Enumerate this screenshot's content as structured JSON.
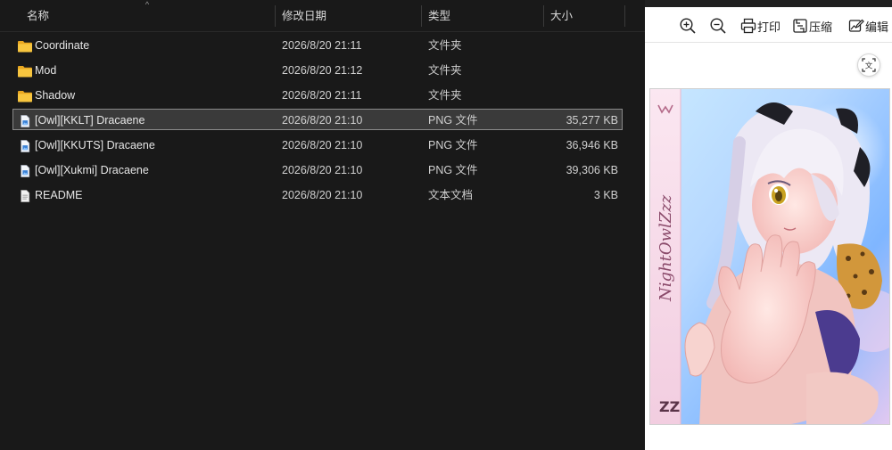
{
  "explorer": {
    "columns": {
      "name": "名称",
      "modified": "修改日期",
      "type": "类型",
      "size": "大小"
    },
    "files": [
      {
        "name": "Coordinate",
        "modified": "2026/8/20 21:11",
        "type": "文件夹",
        "size": "",
        "icon": "folder-icon"
      },
      {
        "name": "Mod",
        "modified": "2026/8/20 21:12",
        "type": "文件夹",
        "size": "",
        "icon": "folder-icon"
      },
      {
        "name": "Shadow",
        "modified": "2026/8/20 21:11",
        "type": "文件夹",
        "size": "",
        "icon": "folder-icon"
      },
      {
        "name": "[Owl][KKLT] Dracaene",
        "modified": "2026/8/20 21:10",
        "type": "PNG 文件",
        "size": "35,277 KB",
        "icon": "png-file-icon",
        "selected": true
      },
      {
        "name": "[Owl][KKUTS] Dracaene",
        "modified": "2026/8/20 21:10",
        "type": "PNG 文件",
        "size": "36,946 KB",
        "icon": "png-file-icon"
      },
      {
        "name": "[Owl][Xukmi] Dracaene",
        "modified": "2026/8/20 21:10",
        "type": "PNG 文件",
        "size": "39,306 KB",
        "icon": "png-file-icon"
      },
      {
        "name": "README",
        "modified": "2026/8/20 21:10",
        "type": "文本文档",
        "size": "3 KB",
        "icon": "text-file-icon"
      }
    ]
  },
  "preview": {
    "toolbar": {
      "print": "打印",
      "compress": "压缩",
      "edit": "编辑"
    },
    "image": {
      "side_text": "NightOwlZzz",
      "subject": "anime girl with silver hair and yellow eye reaching toward viewer"
    }
  },
  "colors": {
    "background": "#191919",
    "selected_row": "#3a3a3a",
    "folder": "#f0b429",
    "preview_bg": "#ffffff"
  }
}
